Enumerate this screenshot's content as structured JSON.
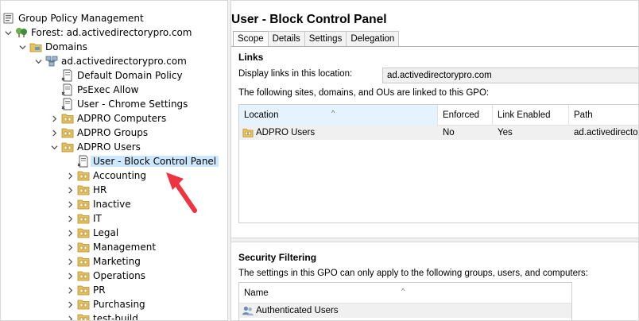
{
  "tree": {
    "items": [
      {
        "label": "Group Policy Management",
        "icon": "gpm-console-icon",
        "chevron": "none"
      },
      {
        "label": "Forest: ad.activedirectorypro.com",
        "icon": "forest-icon",
        "chevron": "expanded"
      },
      {
        "label": "Domains",
        "icon": "domains-folder-icon",
        "chevron": "expanded"
      },
      {
        "label": "ad.activedirectorypro.com",
        "icon": "domain-icon",
        "chevron": "expanded"
      },
      {
        "label": "Default Domain Policy",
        "icon": "gpo-link-icon",
        "chevron": "none"
      },
      {
        "label": "PsExec Allow",
        "icon": "gpo-link-icon",
        "chevron": "none"
      },
      {
        "label": "User - Chrome Settings",
        "icon": "gpo-link-icon",
        "chevron": "none"
      },
      {
        "label": "ADPRO Computers",
        "icon": "ou-folder-icon",
        "chevron": "collapsed"
      },
      {
        "label": "ADPRO Groups",
        "icon": "ou-folder-icon",
        "chevron": "collapsed"
      },
      {
        "label": "ADPRO Users",
        "icon": "ou-folder-icon",
        "chevron": "expanded"
      },
      {
        "label": "User - Block Control Panel",
        "icon": "gpo-link-icon",
        "chevron": "none",
        "selected": true
      },
      {
        "label": "Accounting",
        "icon": "ou-folder-icon",
        "chevron": "collapsed"
      },
      {
        "label": "HR",
        "icon": "ou-folder-icon",
        "chevron": "collapsed"
      },
      {
        "label": "Inactive",
        "icon": "ou-folder-icon",
        "chevron": "collapsed"
      },
      {
        "label": "IT",
        "icon": "ou-folder-icon",
        "chevron": "collapsed"
      },
      {
        "label": "Legal",
        "icon": "ou-folder-icon",
        "chevron": "collapsed"
      },
      {
        "label": "Management",
        "icon": "ou-folder-icon",
        "chevron": "collapsed"
      },
      {
        "label": "Marketing",
        "icon": "ou-folder-icon",
        "chevron": "collapsed"
      },
      {
        "label": "Operations",
        "icon": "ou-folder-icon",
        "chevron": "collapsed"
      },
      {
        "label": "PR",
        "icon": "ou-folder-icon",
        "chevron": "collapsed"
      },
      {
        "label": "Purchasing",
        "icon": "ou-folder-icon",
        "chevron": "collapsed"
      },
      {
        "label": "test-build",
        "icon": "ou-folder-icon",
        "chevron": "collapsed"
      }
    ]
  },
  "main": {
    "title": "User - Block Control Panel",
    "tabs": [
      {
        "label": "Scope",
        "active": true
      },
      {
        "label": "Details"
      },
      {
        "label": "Settings"
      },
      {
        "label": "Delegation"
      }
    ],
    "links": {
      "heading": "Links",
      "display_label": "Display links in this location:",
      "display_value": "ad.activedirectorypro.com",
      "description": "The following sites, domains, and OUs are linked to this GPO:",
      "columns": [
        "Location",
        "Enforced",
        "Link Enabled",
        "Path"
      ],
      "rows": [
        {
          "location": "ADPRO Users",
          "enforced": "No",
          "link_enabled": "Yes",
          "path": "ad.activedirector"
        }
      ]
    },
    "security": {
      "heading": "Security Filtering",
      "description": "The settings in this GPO can only apply to the following groups, users, and computers:",
      "columns": [
        "Name"
      ],
      "rows": [
        {
          "name": "Authenticated Users"
        }
      ]
    }
  },
  "colors": {
    "selection": "#cce8ff",
    "sorted_header": "#e5f3ff",
    "annotation_arrow": "#ef3340",
    "folder": "#e8c25a"
  }
}
